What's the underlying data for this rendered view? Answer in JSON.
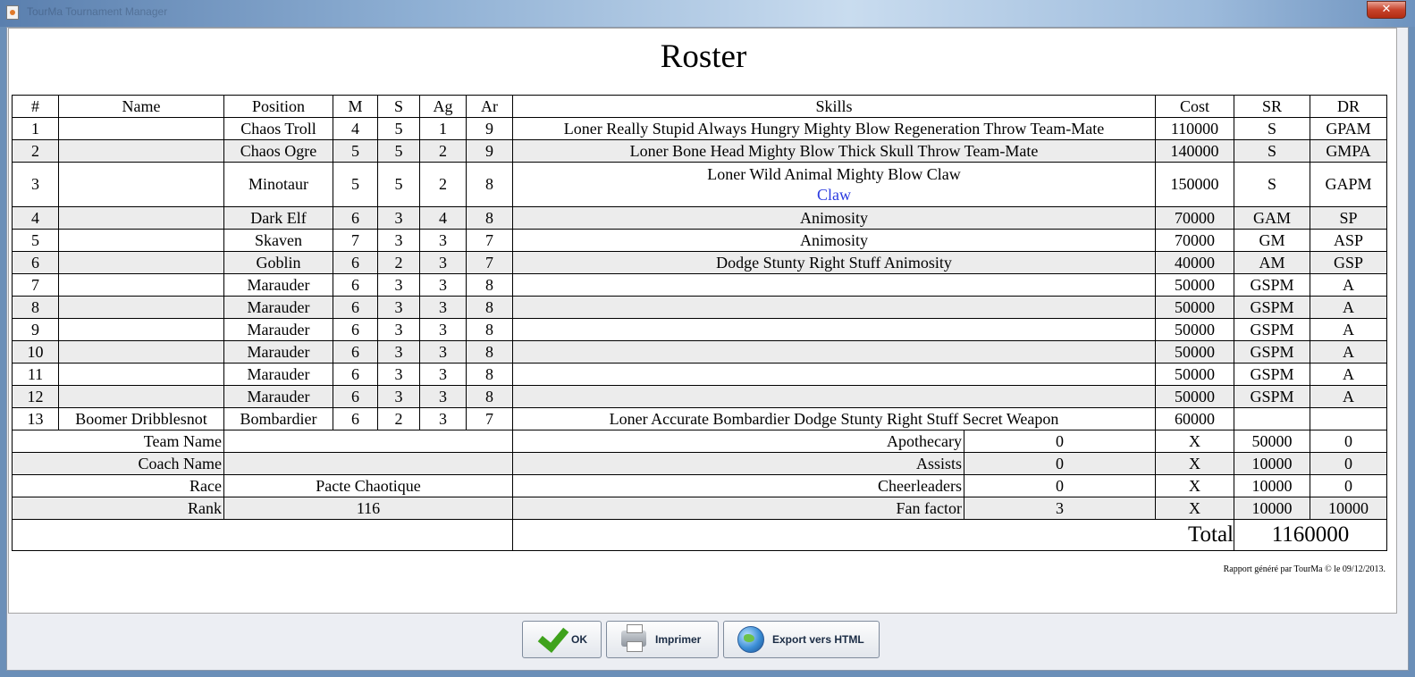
{
  "window": {
    "title": "TourMa Tournament Manager",
    "close_glyph": "✕"
  },
  "page_title": "Roster",
  "columns": [
    "#",
    "Name",
    "Position",
    "M",
    "S",
    "Ag",
    "Ar",
    "Skills",
    "Cost",
    "SR",
    "DR"
  ],
  "players": [
    {
      "num": "1",
      "name": "",
      "position": "Chaos Troll",
      "m": "4",
      "s": "5",
      "ag": "1",
      "ar": "9",
      "skills": "Loner Really Stupid Always Hungry Mighty Blow Regeneration Throw Team-Mate",
      "cost": "110000",
      "sr": "S",
      "dr": "GPAM"
    },
    {
      "num": "2",
      "name": "",
      "position": "Chaos Ogre",
      "m": "5",
      "s": "5",
      "ag": "2",
      "ar": "9",
      "skills": "Loner Bone Head Mighty Blow Thick Skull Throw Team-Mate",
      "cost": "140000",
      "sr": "S",
      "dr": "GMPA"
    },
    {
      "num": "3",
      "name": "",
      "position": "Minotaur",
      "m": "5",
      "s": "5",
      "ag": "2",
      "ar": "8",
      "skills": "Loner Wild Animal Mighty Blow Claw",
      "extra_skill": "Claw",
      "cost": "150000",
      "sr": "S",
      "dr": "GAPM"
    },
    {
      "num": "4",
      "name": "",
      "position": "Dark Elf",
      "m": "6",
      "s": "3",
      "ag": "4",
      "ar": "8",
      "skills": "Animosity",
      "cost": "70000",
      "sr": "GAM",
      "dr": "SP"
    },
    {
      "num": "5",
      "name": "",
      "position": "Skaven",
      "m": "7",
      "s": "3",
      "ag": "3",
      "ar": "7",
      "skills": "Animosity",
      "cost": "70000",
      "sr": "GM",
      "dr": "ASP"
    },
    {
      "num": "6",
      "name": "",
      "position": "Goblin",
      "m": "6",
      "s": "2",
      "ag": "3",
      "ar": "7",
      "skills": "Dodge Stunty Right Stuff Animosity",
      "cost": "40000",
      "sr": "AM",
      "dr": "GSP"
    },
    {
      "num": "7",
      "name": "",
      "position": "Marauder",
      "m": "6",
      "s": "3",
      "ag": "3",
      "ar": "8",
      "skills": "",
      "cost": "50000",
      "sr": "GSPM",
      "dr": "A"
    },
    {
      "num": "8",
      "name": "",
      "position": "Marauder",
      "m": "6",
      "s": "3",
      "ag": "3",
      "ar": "8",
      "skills": "",
      "cost": "50000",
      "sr": "GSPM",
      "dr": "A"
    },
    {
      "num": "9",
      "name": "",
      "position": "Marauder",
      "m": "6",
      "s": "3",
      "ag": "3",
      "ar": "8",
      "skills": "",
      "cost": "50000",
      "sr": "GSPM",
      "dr": "A"
    },
    {
      "num": "10",
      "name": "",
      "position": "Marauder",
      "m": "6",
      "s": "3",
      "ag": "3",
      "ar": "8",
      "skills": "",
      "cost": "50000",
      "sr": "GSPM",
      "dr": "A"
    },
    {
      "num": "11",
      "name": "",
      "position": "Marauder",
      "m": "6",
      "s": "3",
      "ag": "3",
      "ar": "8",
      "skills": "",
      "cost": "50000",
      "sr": "GSPM",
      "dr": "A"
    },
    {
      "num": "12",
      "name": "",
      "position": "Marauder",
      "m": "6",
      "s": "3",
      "ag": "3",
      "ar": "8",
      "skills": "",
      "cost": "50000",
      "sr": "GSPM",
      "dr": "A"
    },
    {
      "num": "13",
      "name": "Boomer Dribblesnot",
      "position": "Bombardier",
      "m": "6",
      "s": "2",
      "ag": "3",
      "ar": "7",
      "skills": "Loner Accurate Bombardier Dodge Stunty Right Stuff Secret Weapon",
      "cost": "60000",
      "sr": "",
      "dr": ""
    }
  ],
  "team_info": [
    {
      "label": "Team Name",
      "value": ""
    },
    {
      "label": "Coach Name",
      "value": ""
    },
    {
      "label": "Race",
      "value": "Pacte Chaotique"
    },
    {
      "label": "Rank",
      "value": "116"
    }
  ],
  "extras": [
    {
      "label": "Apothecary",
      "qty": "0",
      "x": "X",
      "unit": "50000",
      "total": "0"
    },
    {
      "label": "Assists",
      "qty": "0",
      "x": "X",
      "unit": "10000",
      "total": "0"
    },
    {
      "label": "Cheerleaders",
      "qty": "0",
      "x": "X",
      "unit": "10000",
      "total": "0"
    },
    {
      "label": "Fan factor",
      "qty": "3",
      "x": "X",
      "unit": "10000",
      "total": "10000"
    }
  ],
  "total": {
    "label": "Total",
    "value": "1160000"
  },
  "footer_note": "Rapport généré par TourMa © le 09/12/2013.",
  "buttons": {
    "ok": "OK",
    "print": "Imprimer",
    "export": "Export vers HTML"
  }
}
